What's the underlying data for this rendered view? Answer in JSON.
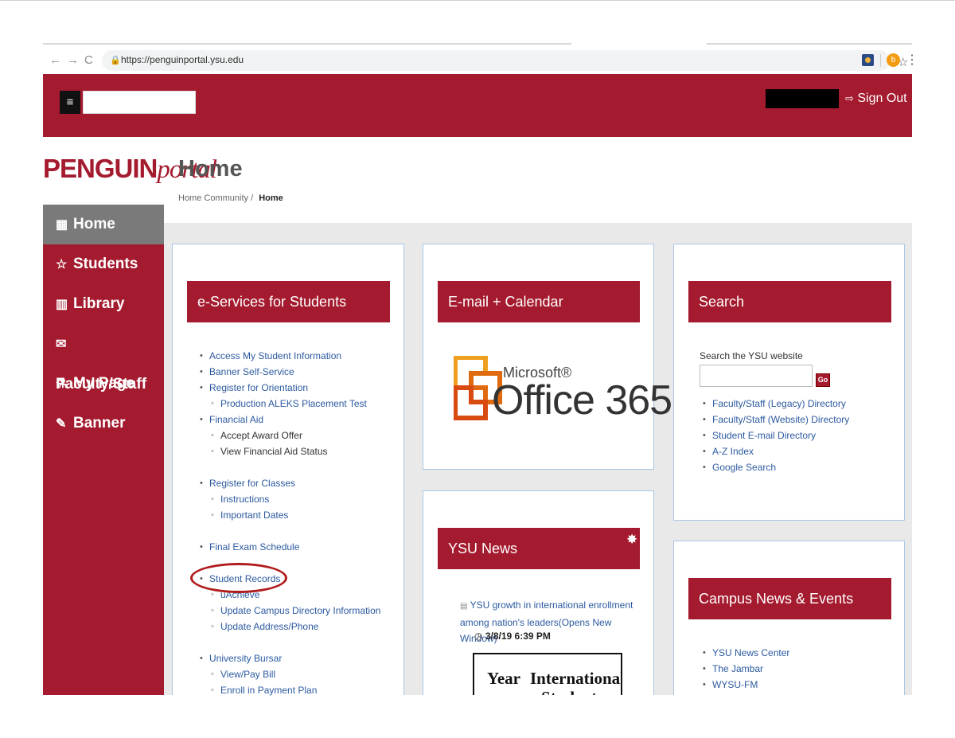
{
  "browser": {
    "url": "https://penguinportal.ysu.edu",
    "ext_badge": "b"
  },
  "header": {
    "menu_icon": "≡",
    "sign_out": "Sign Out"
  },
  "logo": {
    "bold": "PENGUIN",
    "italic": "portal"
  },
  "page": {
    "title": "Home",
    "breadcrumb": {
      "parent": "Home Community",
      "separator": "/",
      "current": "Home"
    }
  },
  "sidebar": {
    "items": [
      {
        "icon": "grid-icon",
        "glyph": "▦",
        "label": "Home",
        "active": true
      },
      {
        "icon": "star-icon",
        "glyph": "☆",
        "label": "Students"
      },
      {
        "icon": "chart-icon",
        "glyph": "▥",
        "label": "Library"
      },
      {
        "icon": "envelope-icon",
        "glyph": "✉",
        "label": "Faculty/Staff"
      },
      {
        "icon": "flask-icon",
        "glyph": "⚗",
        "label": "My Page"
      },
      {
        "icon": "edit-icon",
        "glyph": "✎",
        "label": "Banner"
      }
    ]
  },
  "eservices": {
    "title": "e-Services for Students",
    "links": [
      "Access My Student Information",
      "Banner Self-Service",
      "Register for Orientation",
      "Production ALEKS Placement Test",
      "Financial Aid",
      "Accept Award Offer",
      "View Financial Aid Status",
      "Register for Classes",
      "Instructions",
      "Important Dates",
      "Final Exam Schedule",
      "Student Records",
      "uAchieve",
      "Update Campus Directory Information",
      "Update Address/Phone",
      "University Bursar",
      "View/Pay Bill",
      "Enroll in Payment Plan"
    ]
  },
  "email": {
    "title": "E-mail + Calendar",
    "brand_small": "Microsoft®",
    "brand_large": "Office 365"
  },
  "news": {
    "title": "YSU News",
    "item": "YSU growth in international enrollment among nation's leaders(Opens New Window)",
    "date": "3/8/19 6:39 PM",
    "image_text": {
      "a": "Year",
      "b": "International",
      "c": "Students"
    }
  },
  "search": {
    "title": "Search",
    "label": "Search the YSU website",
    "go": "Go",
    "links": [
      "Faculty/Staff (Legacy) Directory",
      "Faculty/Staff (Website) Directory",
      "Student E-mail Directory",
      "A-Z Index",
      "Google Search"
    ]
  },
  "campus": {
    "title": "Campus News & Events",
    "links": [
      "YSU News Center",
      "The Jambar",
      "WYSU-FM"
    ]
  },
  "colors": {
    "brand": "#a41a2e",
    "link": "#2c5aa0",
    "sidebar_active": "#7a7a7a"
  }
}
